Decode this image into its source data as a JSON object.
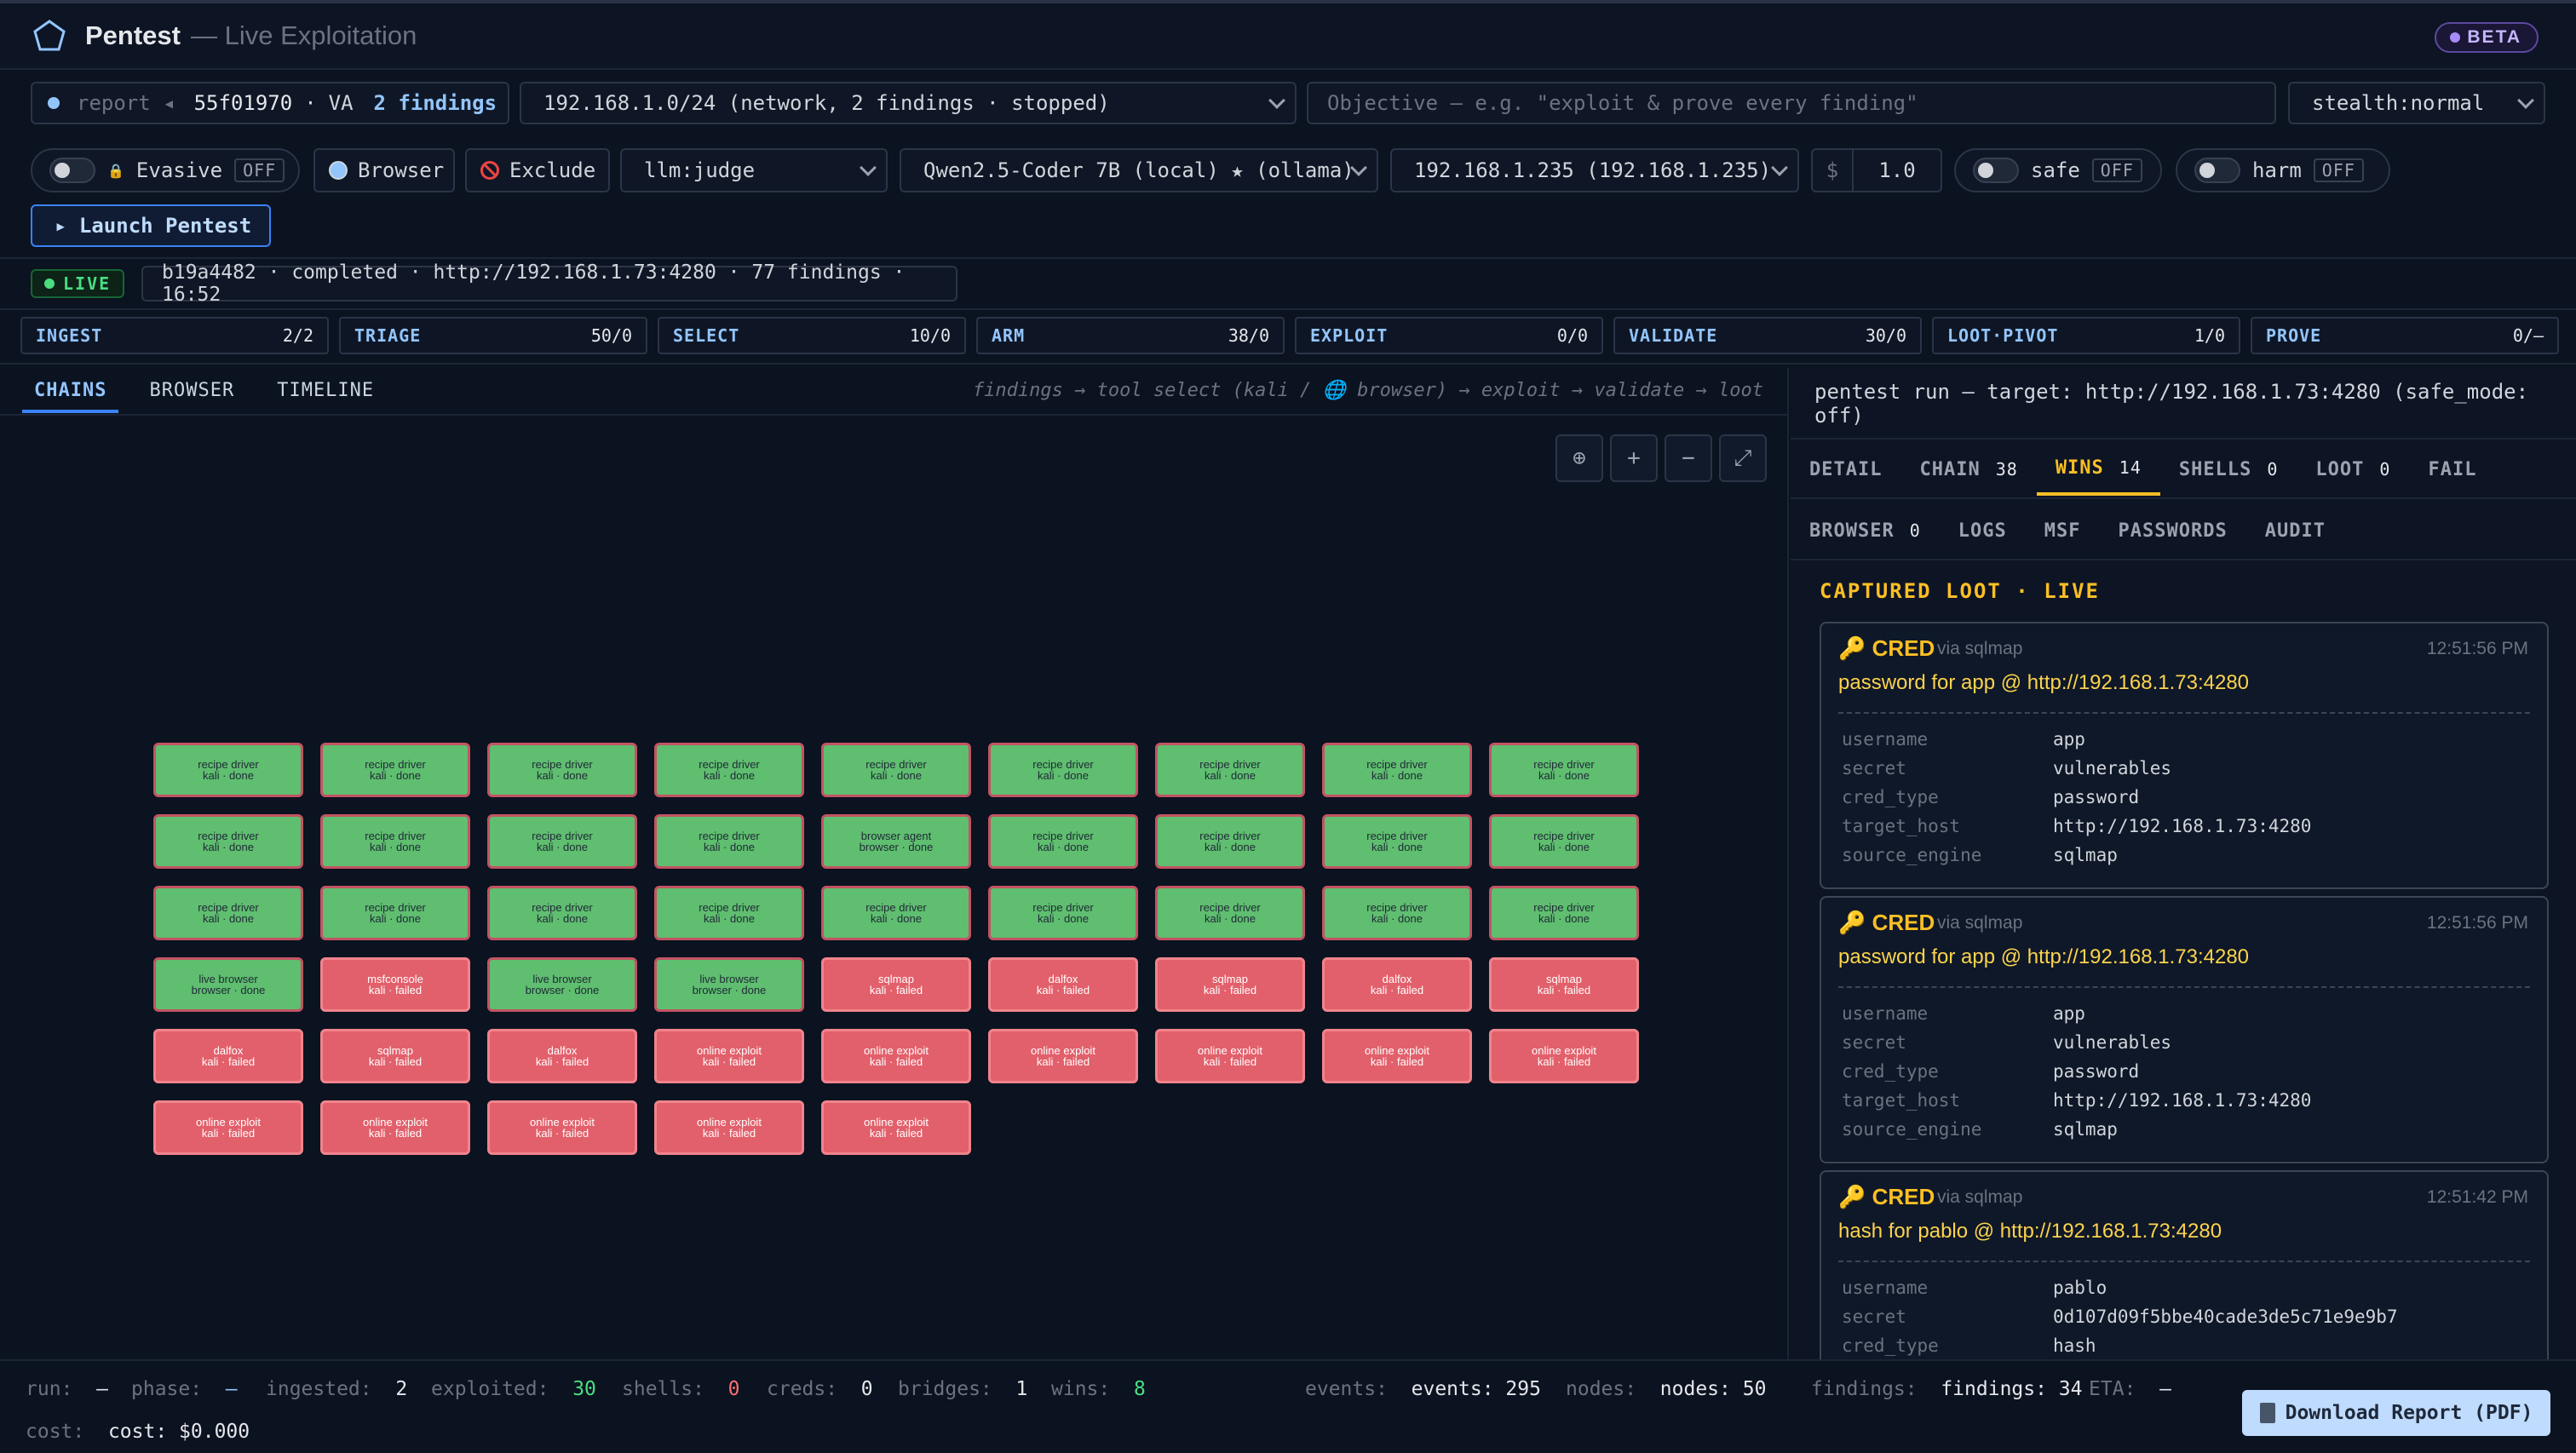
{
  "app": {
    "title": "Pentest",
    "subtitle": "— Live Exploitation",
    "badge": "BETA"
  },
  "toolbar1": {
    "report_label": "report ◂",
    "report_id": "55f01970",
    "report_sep": "·",
    "report_va": "VA",
    "report_findings": "2 findings",
    "scope_select": "192.168.1.0/24 (network, 2 findings · stopped)",
    "objective_placeholder": "Objective — e.g. \"exploit & prove every finding\"",
    "mode_select": "stealth:normal"
  },
  "toolbar2": {
    "evasive_label": "Evasive",
    "evasive_state": "OFF",
    "browser_label": "Browser",
    "exclude_label": "Exclude",
    "judge_select": "llm:judge",
    "model_select": "Qwen2.5-Coder 7B (local) ★ (ollama)",
    "target_select": "192.168.1.235 (192.168.1.235)",
    "budget_symbol": "$",
    "budget_value": "1.0",
    "safe_label": "safe",
    "safe_state": "OFF",
    "harm_label": "harm",
    "harm_state": "OFF",
    "launch_label": "▸ Launch Pentest"
  },
  "run": {
    "live_label": "LIVE",
    "summary": "b19a4482 · completed · http://192.168.1.73:4280 · 77 findings · 16:52"
  },
  "stages": [
    {
      "name": "INGEST",
      "count": "2/2"
    },
    {
      "name": "TRIAGE",
      "count": "50/0"
    },
    {
      "name": "SELECT",
      "count": "10/0"
    },
    {
      "name": "ARM",
      "count": "38/0"
    },
    {
      "name": "EXPLOIT",
      "count": "0/0"
    },
    {
      "name": "VALIDATE",
      "count": "30/0"
    },
    {
      "name": "LOOT·PIVOT",
      "count": "1/0"
    },
    {
      "name": "PROVE",
      "count": "0/—"
    }
  ],
  "left": {
    "tabs": [
      "CHAINS",
      "BROWSER",
      "TIMELINE"
    ],
    "flow_hint": "findings → tool select (kali / 🌐 browser) → exploit → validate → loot",
    "zoom_buttons": [
      "⊕",
      "+",
      "−",
      "⤢"
    ]
  },
  "graph": {
    "nodes": [
      {
        "title": "recipe driver",
        "sub": "kali · done",
        "status": "done"
      },
      {
        "title": "recipe driver",
        "sub": "kali · done",
        "status": "done"
      },
      {
        "title": "recipe driver",
        "sub": "kali · done",
        "status": "done"
      },
      {
        "title": "recipe driver",
        "sub": "kali · done",
        "status": "done"
      },
      {
        "title": "recipe driver",
        "sub": "kali · done",
        "status": "done"
      },
      {
        "title": "recipe driver",
        "sub": "kali · done",
        "status": "done"
      },
      {
        "title": "recipe driver",
        "sub": "kali · done",
        "status": "done"
      },
      {
        "title": "recipe driver",
        "sub": "kali · done",
        "status": "done"
      },
      {
        "title": "recipe driver",
        "sub": "kali · done",
        "status": "done"
      },
      {
        "title": "recipe driver",
        "sub": "kali · done",
        "status": "done"
      },
      {
        "title": "recipe driver",
        "sub": "kali · done",
        "status": "done"
      },
      {
        "title": "recipe driver",
        "sub": "kali · done",
        "status": "done"
      },
      {
        "title": "recipe driver",
        "sub": "kali · done",
        "status": "done"
      },
      {
        "title": "browser agent",
        "sub": "browser · done",
        "status": "done"
      },
      {
        "title": "recipe driver",
        "sub": "kali · done",
        "status": "done"
      },
      {
        "title": "recipe driver",
        "sub": "kali · done",
        "status": "done"
      },
      {
        "title": "recipe driver",
        "sub": "kali · done",
        "status": "done"
      },
      {
        "title": "recipe driver",
        "sub": "kali · done",
        "status": "done"
      },
      {
        "title": "recipe driver",
        "sub": "kali · done",
        "status": "done"
      },
      {
        "title": "recipe driver",
        "sub": "kali · done",
        "status": "done"
      },
      {
        "title": "recipe driver",
        "sub": "kali · done",
        "status": "done"
      },
      {
        "title": "recipe driver",
        "sub": "kali · done",
        "status": "done"
      },
      {
        "title": "recipe driver",
        "sub": "kali · done",
        "status": "done"
      },
      {
        "title": "recipe driver",
        "sub": "kali · done",
        "status": "done"
      },
      {
        "title": "recipe driver",
        "sub": "kali · done",
        "status": "done"
      },
      {
        "title": "recipe driver",
        "sub": "kali · done",
        "status": "done"
      },
      {
        "title": "recipe driver",
        "sub": "kali · done",
        "status": "done"
      },
      {
        "title": "live browser",
        "sub": "browser · done",
        "status": "done"
      },
      {
        "title": "msfconsole",
        "sub": "kali · failed",
        "status": "failed"
      },
      {
        "title": "live browser",
        "sub": "browser · done",
        "status": "done"
      },
      {
        "title": "live browser",
        "sub": "browser · done",
        "status": "done"
      },
      {
        "title": "sqlmap",
        "sub": "kali · failed",
        "status": "failed"
      },
      {
        "title": "dalfox",
        "sub": "kali · failed",
        "status": "failed"
      },
      {
        "title": "sqlmap",
        "sub": "kali · failed",
        "status": "failed"
      },
      {
        "title": "dalfox",
        "sub": "kali · failed",
        "status": "failed"
      },
      {
        "title": "sqlmap",
        "sub": "kali · failed",
        "status": "failed"
      },
      {
        "title": "dalfox",
        "sub": "kali · failed",
        "status": "failed"
      },
      {
        "title": "sqlmap",
        "sub": "kali · failed",
        "status": "failed"
      },
      {
        "title": "dalfox",
        "sub": "kali · failed",
        "status": "failed"
      },
      {
        "title": "online exploit",
        "sub": "kali · failed",
        "status": "failed"
      },
      {
        "title": "online exploit",
        "sub": "kali · failed",
        "status": "failed"
      },
      {
        "title": "online exploit",
        "sub": "kali · failed",
        "status": "failed"
      },
      {
        "title": "online exploit",
        "sub": "kali · failed",
        "status": "failed"
      },
      {
        "title": "online exploit",
        "sub": "kali · failed",
        "status": "failed"
      },
      {
        "title": "online exploit",
        "sub": "kali · failed",
        "status": "failed"
      },
      {
        "title": "online exploit",
        "sub": "kali · failed",
        "status": "failed"
      },
      {
        "title": "online exploit",
        "sub": "kali · failed",
        "status": "failed"
      },
      {
        "title": "online exploit",
        "sub": "kali · failed",
        "status": "failed"
      },
      {
        "title": "online exploit",
        "sub": "kali · failed",
        "status": "failed"
      },
      {
        "title": "online exploit",
        "sub": "kali · failed",
        "status": "failed"
      }
    ]
  },
  "right": {
    "run_title": "pentest run — target: http://192.168.1.73:4280 (safe_mode: off)",
    "tabs_row1": [
      {
        "label": "DETAIL",
        "count": ""
      },
      {
        "label": "CHAIN",
        "count": "38"
      },
      {
        "label": "WINS",
        "count": "14"
      },
      {
        "label": "SHELLS",
        "count": "0"
      },
      {
        "label": "LOOT",
        "count": "0"
      },
      {
        "label": "FAIL",
        "count": ""
      }
    ],
    "tabs_row2": [
      {
        "label": "BROWSER",
        "count": "0"
      },
      {
        "label": "LOGS",
        "count": ""
      },
      {
        "label": "MSF",
        "count": ""
      },
      {
        "label": "PASSWORDS",
        "count": ""
      },
      {
        "label": "AUDIT",
        "count": ""
      }
    ],
    "loot_heading": "CAPTURED LOOT · LIVE",
    "cards": [
      {
        "kind": "CRED",
        "via": "via sqlmap",
        "time": "12:51:56 PM",
        "desc": "password for app @ http://192.168.1.73:4280",
        "fields": [
          {
            "k": "username",
            "v": "app"
          },
          {
            "k": "secret",
            "v": "vulnerables"
          },
          {
            "k": "cred_type",
            "v": "password"
          },
          {
            "k": "target_host",
            "v": "http://192.168.1.73:4280"
          },
          {
            "k": "source_engine",
            "v": "sqlmap"
          }
        ]
      },
      {
        "kind": "CRED",
        "via": "via sqlmap",
        "time": "12:51:56 PM",
        "desc": "password for app @ http://192.168.1.73:4280",
        "fields": [
          {
            "k": "username",
            "v": "app"
          },
          {
            "k": "secret",
            "v": "vulnerables"
          },
          {
            "k": "cred_type",
            "v": "password"
          },
          {
            "k": "target_host",
            "v": "http://192.168.1.73:4280"
          },
          {
            "k": "source_engine",
            "v": "sqlmap"
          }
        ]
      },
      {
        "kind": "CRED",
        "via": "via sqlmap",
        "time": "12:51:42 PM",
        "desc": "hash for pablo @ http://192.168.1.73:4280",
        "fields": [
          {
            "k": "username",
            "v": "pablo"
          },
          {
            "k": "secret",
            "v": "0d107d09f5bbe40cade3de5c71e9e9b7"
          },
          {
            "k": "cred_type",
            "v": "hash"
          }
        ]
      }
    ]
  },
  "status": {
    "run_k": "run:",
    "run_v": "—",
    "phase_k": "phase:",
    "phase_v": "—",
    "ingested_k": "ingested:",
    "ingested_v": "2",
    "exploited_k": "exploited:",
    "exploited_v": "30",
    "shells_k": "shells:",
    "shells_v": "0",
    "creds_k": "creds:",
    "creds_v": "0",
    "bridges_k": "bridges:",
    "bridges_v": "1",
    "wins_k": "wins:",
    "wins_v": "8",
    "events_k": "events:",
    "events_v": "events: 295",
    "nodes_k": "nodes:",
    "nodes_v": "nodes: 50",
    "findings_k": "findings:",
    "findings_v": "findings: 34",
    "eta_k": "ETA:",
    "eta_v": "—",
    "cost_k": "cost:",
    "cost_v": "cost: $0.000",
    "download_label": "Download Report (PDF)"
  }
}
